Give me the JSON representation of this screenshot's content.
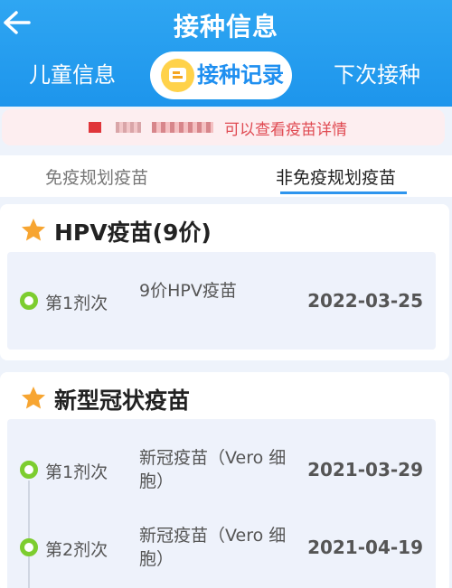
{
  "header": {
    "title": "接种信息"
  },
  "tabs": [
    {
      "label": "儿童信息"
    },
    {
      "label": "接种记录"
    },
    {
      "label": "下次接种"
    }
  ],
  "notice": {
    "text": "可以查看疫苗详情"
  },
  "subtabs": [
    {
      "label": "免疫规划疫苗"
    },
    {
      "label": "非免疫规划疫苗"
    }
  ],
  "sections": [
    {
      "title": "HPV疫苗(9价)",
      "records": [
        {
          "dose": "第1剂次",
          "name": "9价HPV疫苗",
          "date": "2022-03-25"
        }
      ]
    },
    {
      "title": "新型冠状疫苗",
      "records": [
        {
          "dose": "第1剂次",
          "name": "新冠疫苗（Vero 细胞）",
          "date": "2021-03-29"
        },
        {
          "dose": "第2剂次",
          "name": "新冠疫苗（Vero 细胞）",
          "date": "2021-04-19"
        }
      ]
    }
  ],
  "colors": {
    "header": "#1d95ec",
    "accent": "#1f8ff0",
    "notice_text": "#e04a52",
    "dot": "#7dcd2f"
  }
}
